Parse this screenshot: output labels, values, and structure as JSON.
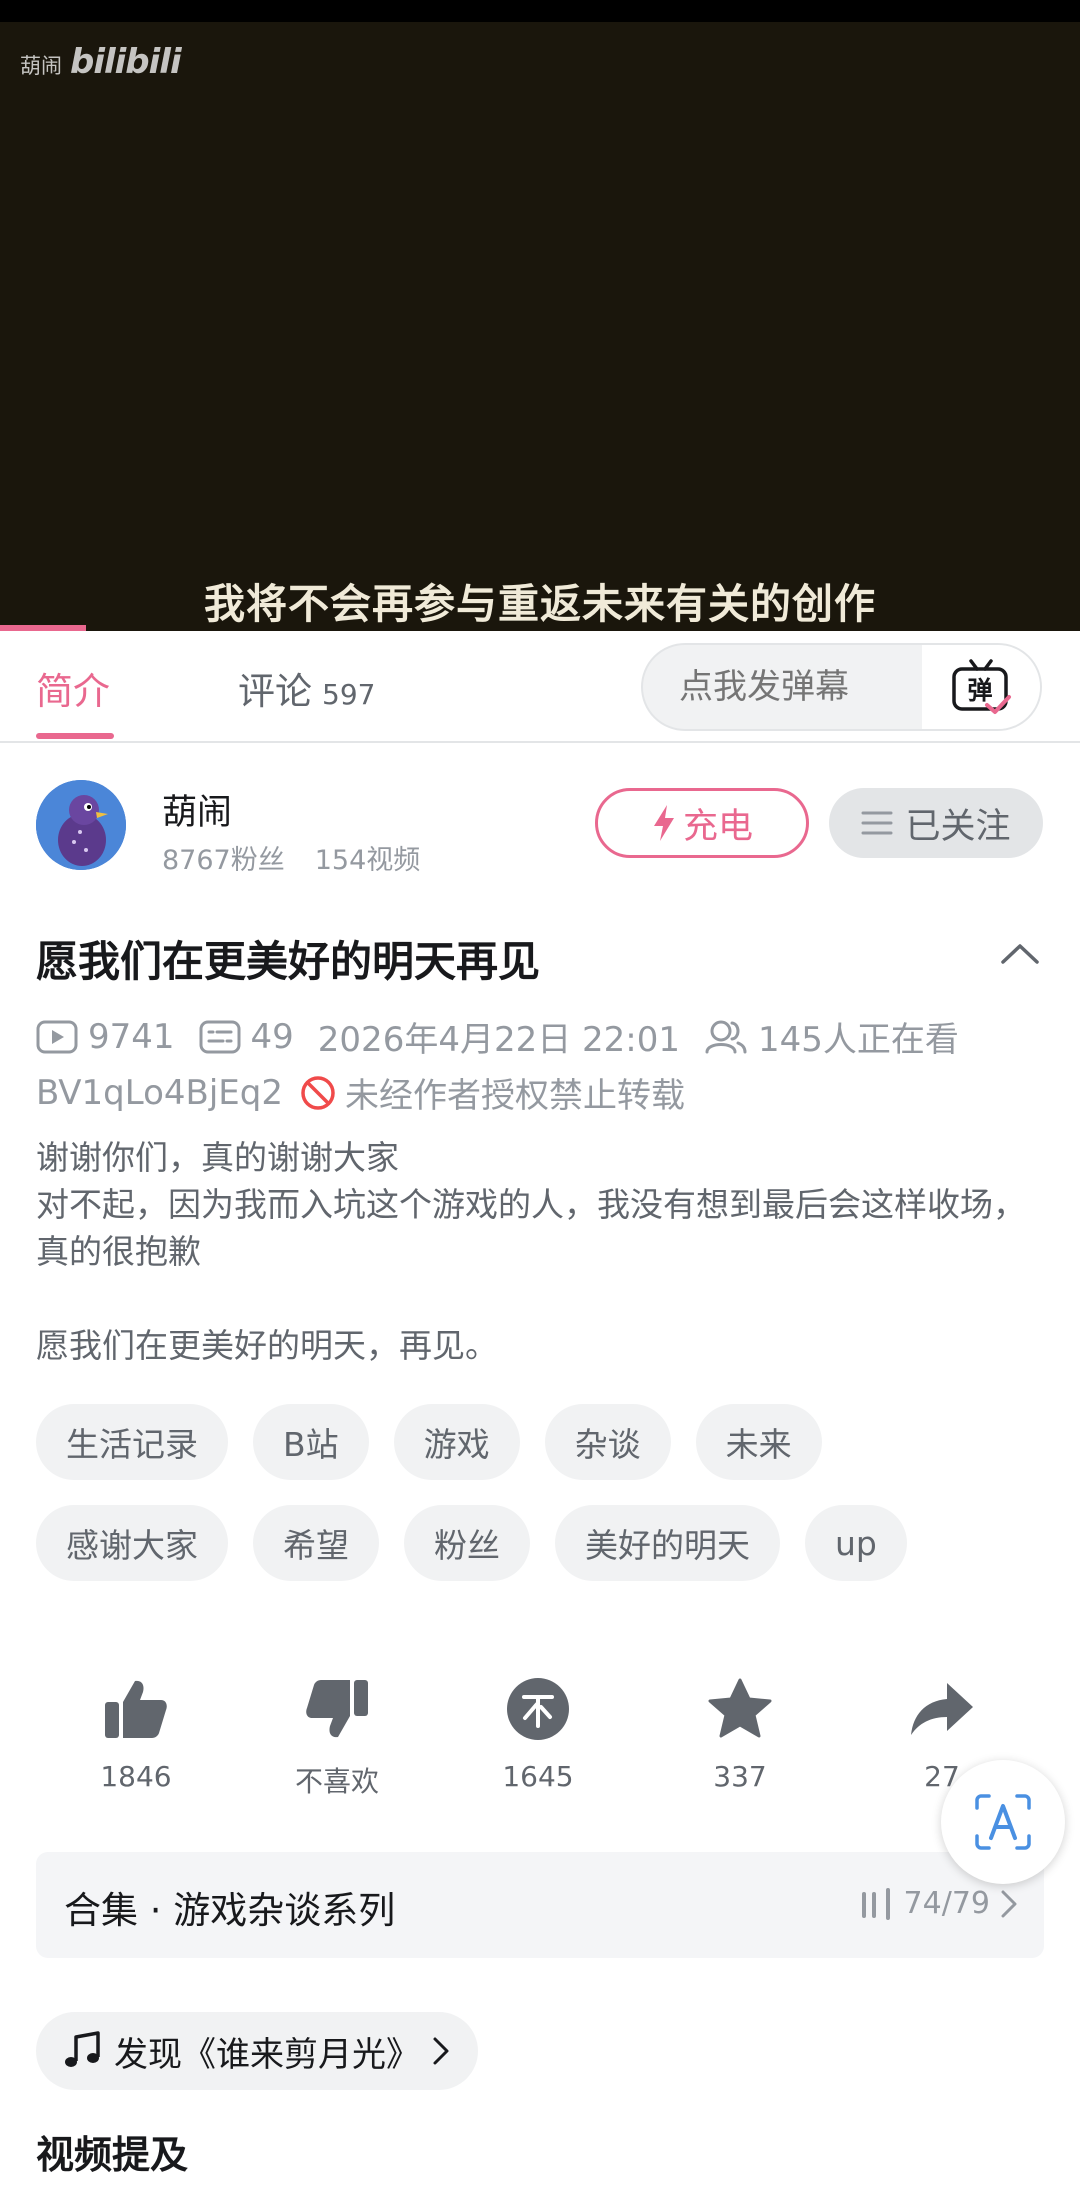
{
  "video": {
    "watermark_name": "葫闹",
    "watermark_logo": "bilibili",
    "subtitle": "我将不会再参与重返未来有关的创作",
    "progress": 0.08
  },
  "tabs": {
    "intro": "简介",
    "comments": "评论",
    "comments_count": "597",
    "danmaku_placeholder": "点我发弹幕",
    "danmaku_icon_char": "弹"
  },
  "uploader": {
    "name": "葫闹",
    "fans": "8767粉丝",
    "videos": "154视频",
    "charge_label": "充电",
    "follow_label": "已关注"
  },
  "video_info": {
    "title": "愿我们在更美好的明天再见",
    "views": "9741",
    "danmaku_count": "49",
    "publish_time": "2026年4月22日 22:01",
    "watching": "145人正在看",
    "bvid": "BV1qLo4BjEq2",
    "repost_notice": "未经作者授权禁止转载"
  },
  "description": [
    "谢谢你们，真的谢谢大家",
    "对不起，因为我而入坑这个游戏的人，我没有想到最后会这样收场，真的很抱歉",
    "",
    "愿我们在更美好的明天，再见。"
  ],
  "tags": {
    "row1": [
      "生活记录",
      "B站",
      "游戏",
      "杂谈",
      "未来"
    ],
    "row2": [
      "感谢大家",
      "希望",
      "粉丝",
      "美好的明天",
      "up"
    ]
  },
  "actions": {
    "like": "1846",
    "dislike": "不喜欢",
    "coin": "1645",
    "favorite": "337",
    "share": "27"
  },
  "collection": {
    "title": "合集 · 游戏杂谈系列",
    "progress": "74/79"
  },
  "music": {
    "label": "发现《谁来剪月光》"
  },
  "section": {
    "title": "视频提及"
  },
  "colors": {
    "accent": "#e9688f",
    "text_primary": "#18191c",
    "text_secondary": "#61666d",
    "text_muted": "#9499a0",
    "video_bg": "#1a160c"
  }
}
